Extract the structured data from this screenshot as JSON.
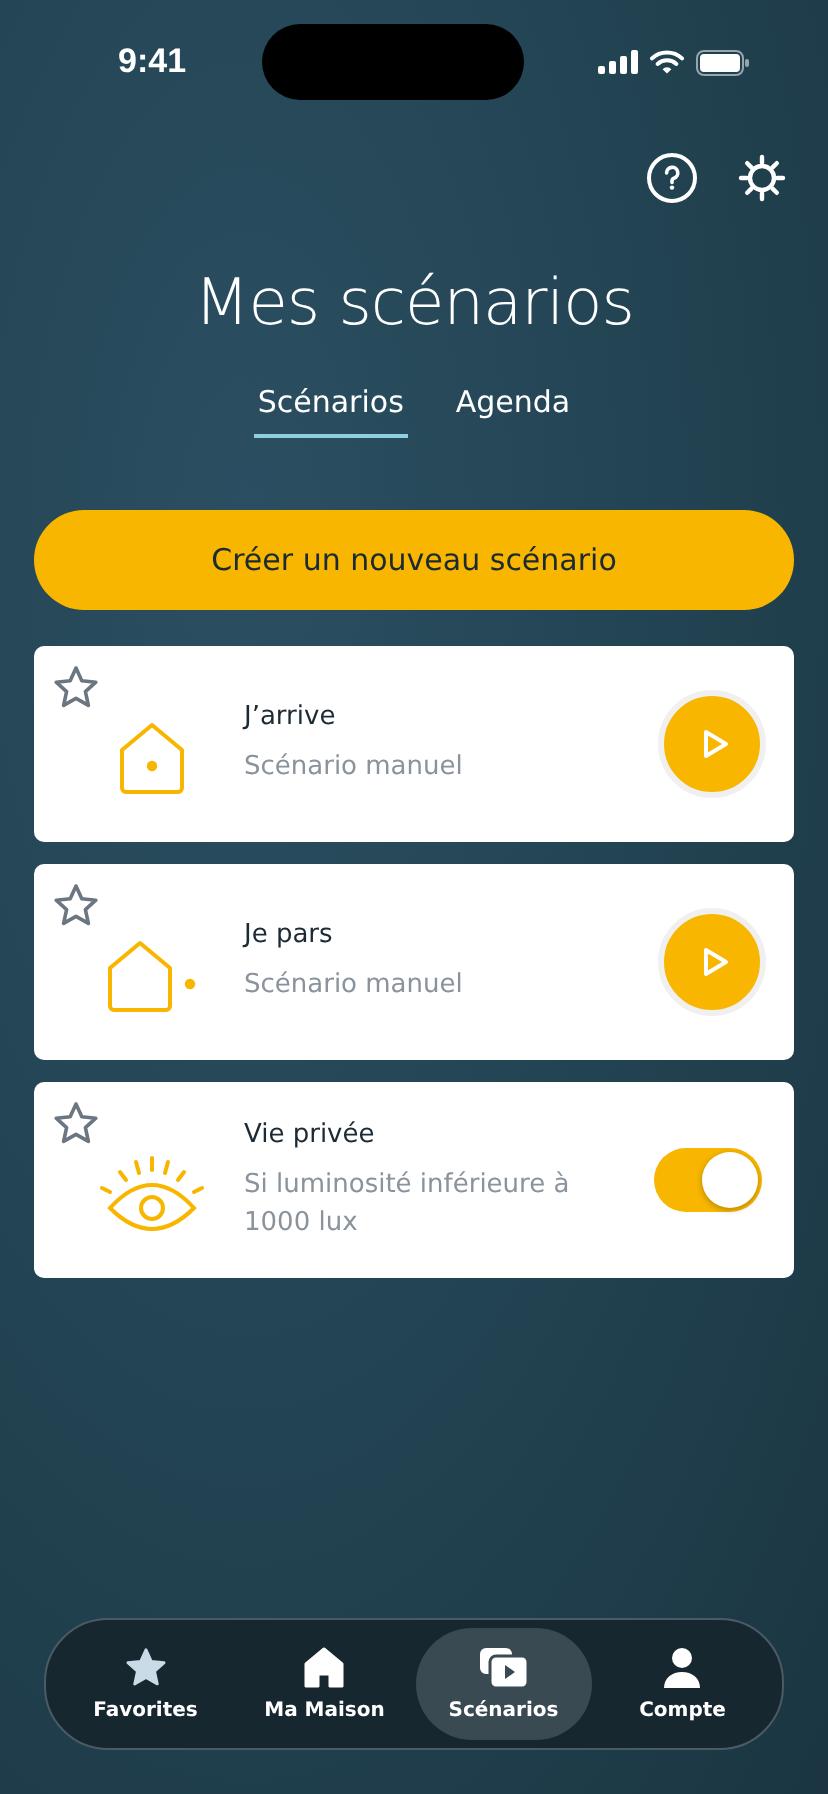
{
  "status_bar": {
    "time": "9:41"
  },
  "title": "Mes scénarios",
  "tabs": [
    {
      "label": "Scénarios",
      "selected": true
    },
    {
      "label": "Agenda",
      "selected": false
    }
  ],
  "create_button": "Créer un nouveau scénario",
  "scenarios": [
    {
      "name": "J’arrive",
      "subtitle": "Scénario manuel",
      "favorite": false,
      "kind": "play"
    },
    {
      "name": "Je pars",
      "subtitle": "Scénario manuel",
      "favorite": false,
      "kind": "play"
    },
    {
      "name": "Vie privée",
      "subtitle": "Si luminosité inférieure à 1000 lux",
      "favorite": false,
      "kind": "toggle",
      "on": true
    }
  ],
  "nav": [
    {
      "label": "Favorites",
      "selected": false
    },
    {
      "label": "Ma Maison",
      "selected": false
    },
    {
      "label": "Scénarios",
      "selected": true
    },
    {
      "label": "Compte",
      "selected": false
    }
  ]
}
